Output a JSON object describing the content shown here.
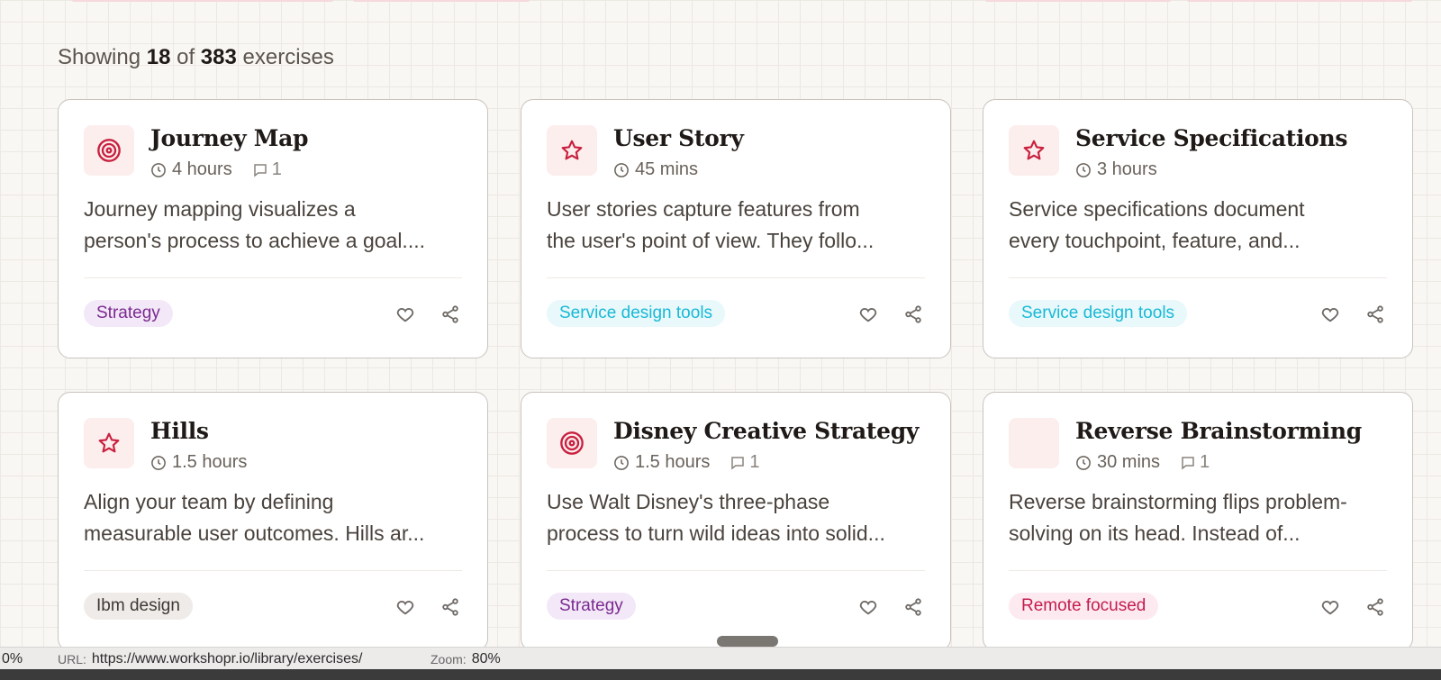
{
  "summary": {
    "prefix": "Showing",
    "shown": "18",
    "of": "of",
    "total": "383",
    "suffix": "exercises"
  },
  "cards": [
    {
      "title": "Journey Map",
      "icon": "target-icon",
      "duration": "4 hours",
      "comments": "1",
      "desc1": "Journey mapping visualizes a",
      "desc2": "person's process to achieve a goal....",
      "tag": "Strategy"
    },
    {
      "title": "User Story",
      "icon": "star-icon",
      "duration": "45 mins",
      "desc1": "User stories capture features from",
      "desc2": "the user's point of view. They follo...",
      "tag": "Service design tools"
    },
    {
      "title": "Service Specifications",
      "icon": "star-icon",
      "duration": "3 hours",
      "desc1": "Service specifications document",
      "desc2": "every touchpoint, feature, and...",
      "tag": "Service design tools"
    },
    {
      "title": "Hills",
      "icon": "star-icon",
      "duration": "1.5 hours",
      "desc1": "Align your team by defining",
      "desc2": "measurable user outcomes. Hills ar...",
      "tag": "Ibm design"
    },
    {
      "title": "Disney Creative Strategy",
      "icon": "target-icon",
      "duration": "1.5 hours",
      "comments": "1",
      "desc1": "Use Walt Disney's three-phase",
      "desc2": "process to turn wild ideas into solid...",
      "tag": "Strategy"
    },
    {
      "title": "Reverse Brainstorming",
      "icon": "",
      "duration": "30 mins",
      "comments": "1",
      "desc1": "Reverse brainstorming flips problem-",
      "desc2": "solving on its head. Instead of...",
      "tag": "Remote focused"
    }
  ],
  "colors": {
    "accent": "#c8213f",
    "icon_bg": "#fdeeee",
    "strategy": "#7b2a91",
    "service": "#19b9d6",
    "remote": "#c41c4f"
  },
  "status_bar": {
    "progress": "0%",
    "url_label": "URL:",
    "url": "https://www.workshopr.io/library/exercises/",
    "zoom_label": "Zoom:",
    "zoom": "80%"
  }
}
